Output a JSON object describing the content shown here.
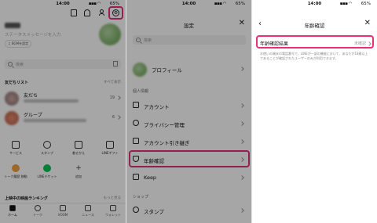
{
  "status": {
    "time": "14:00",
    "battery": "65%"
  },
  "home": {
    "status_message": "ステータスメッセージを入力",
    "bgm_label": "♫ BGMを設定",
    "search_placeholder": "検索",
    "friends_header": "友だちリスト",
    "friends_all": "すべて表示",
    "friends_label": "友だち",
    "friends_count": "19",
    "groups_label": "グループ",
    "groups_count": "6",
    "services": [
      {
        "label": "サービス"
      },
      {
        "label": "スタンプ"
      },
      {
        "label": "着せかえ"
      },
      {
        "label": "LINEギフト"
      },
      {
        "label": "トーク履歴 移動"
      },
      {
        "label": "LINEチケット"
      },
      {
        "label": "追加"
      }
    ],
    "video_ranking": "上映中の映画ランキング",
    "more": "もっと見る",
    "tabs": [
      {
        "label": "ホーム"
      },
      {
        "label": "トーク"
      },
      {
        "label": "VOOM"
      },
      {
        "label": "ニュース"
      },
      {
        "label": "ウォレット"
      }
    ]
  },
  "settings": {
    "title": "設定",
    "search_placeholder": "検索",
    "profile": "プロフィール",
    "personal_section": "個人情報",
    "items": [
      {
        "label": "アカウント"
      },
      {
        "label": "プライバシー管理"
      },
      {
        "label": "アカウント引き継ぎ"
      },
      {
        "label": "年齢確認"
      },
      {
        "label": "Keep"
      }
    ],
    "shop_section": "ショップ",
    "stamps": "スタンプ"
  },
  "age": {
    "title": "年齢確認",
    "result_label": "年齢確認結果",
    "result_value": "未確認",
    "description": "お使いの端末の電話番号で、LINEが一部の機能において、あなたが18歳以上であることが確認されたユーザーのみが利用できます。"
  },
  "colors": {
    "highlight": "#e5307a",
    "line_green": "#06c755"
  }
}
